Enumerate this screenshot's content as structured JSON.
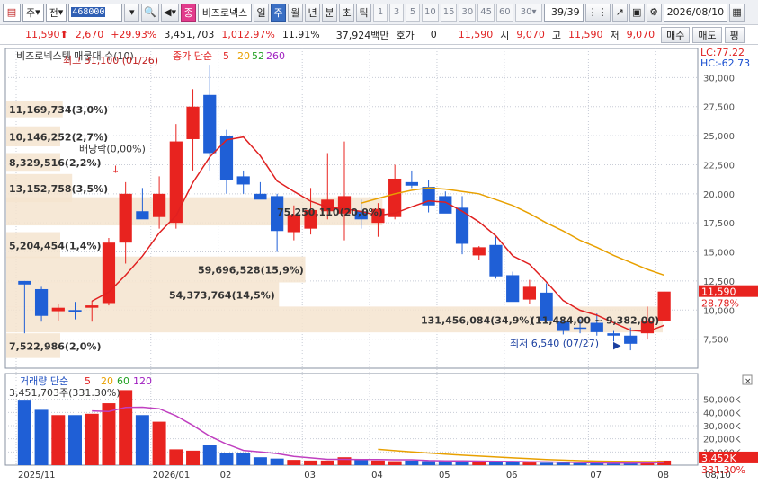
{
  "toolbar": {
    "stock_code": "468000",
    "buy_type": "주",
    "period": "전",
    "stock_name": "비즈로넥스",
    "tabs": [
      "일",
      "주",
      "월",
      "년",
      "분",
      "초",
      "틱"
    ],
    "active_tab": "주",
    "numbers": [
      "1",
      "3",
      "5",
      "10",
      "15",
      "30",
      "45",
      "60",
      "30"
    ],
    "page": "39/39",
    "date": "2026/08/10",
    "badge": "종"
  },
  "quote": {
    "price": "11,590",
    "change": "2,670",
    "change_pct": "+29.93%",
    "volume": "3,451,703",
    "vol_pct": "1,012.97%",
    "turnover": "11.91%",
    "amount": "37,924백만",
    "hoga_label": "호가",
    "hoga_value": "0",
    "bid": "11,590",
    "open_label": "시",
    "open": "9,070",
    "high_label": "고",
    "high": "11,590",
    "low_label": "저",
    "low": "9,070",
    "buy": "매수",
    "sell": "매도",
    "avg": "평"
  },
  "chart_data": {
    "type": "candlestick",
    "price_panel": {
      "title": "비즈로넥스텍 매물대 수(10)",
      "ma_label": "종가 단순",
      "ma_periods": [
        "5",
        "20",
        "52",
        "260"
      ],
      "ma_colors": [
        "#e02020",
        "#e8a000",
        "#20a020",
        "#a020c0"
      ],
      "ylim": [
        5000,
        32500
      ],
      "yticks": [
        7500,
        10000,
        12500,
        15000,
        17500,
        20000,
        22500,
        25000,
        27500,
        30000
      ],
      "ytick_labels": [
        "7,500",
        "10,000",
        "12,500",
        "15,000",
        "17,500",
        "20,000",
        "22,500",
        "25,000",
        "27,500",
        "30,000"
      ],
      "lc": "LC:77.22",
      "hc": "HC:-62.73",
      "price_label": "11,590",
      "pct_label": "28.78%",
      "candles": [
        [
          12500,
          12500,
          8000,
          12200
        ],
        [
          11800,
          12000,
          9000,
          9500
        ],
        [
          9900,
          10500,
          9100,
          10200
        ],
        [
          10000,
          10700,
          9200,
          9800
        ],
        [
          10200,
          10800,
          9000,
          10400
        ],
        [
          10600,
          16200,
          10400,
          15800
        ],
        [
          15800,
          21000,
          14000,
          20000
        ],
        [
          18500,
          20500,
          18000,
          17800
        ],
        [
          18000,
          21500,
          17000,
          20000
        ],
        [
          17500,
          26000,
          17000,
          24500
        ],
        [
          24700,
          29000,
          22000,
          27500
        ],
        [
          28500,
          31100,
          22000,
          23500
        ],
        [
          25000,
          25500,
          20000,
          21200
        ],
        [
          21500,
          22000,
          20000,
          20800
        ],
        [
          20000,
          21000,
          19800,
          19500
        ],
        [
          19800,
          20000,
          15000,
          16800
        ],
        [
          16700,
          19000,
          16000,
          18200
        ],
        [
          17000,
          20500,
          16500,
          18600
        ],
        [
          18500,
          23500,
          17800,
          19500
        ],
        [
          18300,
          24500,
          16000,
          19800
        ],
        [
          18500,
          19500,
          17000,
          17800
        ],
        [
          17500,
          19200,
          16300,
          18700
        ],
        [
          18000,
          22500,
          17800,
          21300
        ],
        [
          21000,
          22000,
          20500,
          20700
        ],
        [
          20600,
          21200,
          18400,
          19000
        ],
        [
          19800,
          20200,
          18400,
          18300
        ],
        [
          18800,
          19800,
          14800,
          15700
        ],
        [
          14700,
          15500,
          14300,
          15400
        ],
        [
          15600,
          16300,
          12700,
          12900
        ],
        [
          13000,
          13300,
          10800,
          10700
        ],
        [
          10900,
          12600,
          10500,
          12000
        ],
        [
          11500,
          12300,
          8900,
          9100
        ],
        [
          9000,
          9200,
          7900,
          8200
        ],
        [
          8500,
          9200,
          8000,
          8400
        ],
        [
          8900,
          9700,
          7800,
          8100
        ],
        [
          8000,
          8200,
          7300,
          7800
        ],
        [
          7800,
          8500,
          6540,
          7100
        ],
        [
          8000,
          10300,
          7500,
          9070
        ],
        [
          9070,
          11590,
          9070,
          11590
        ]
      ],
      "ma5": [
        null,
        null,
        null,
        null,
        10760,
        11540,
        13000,
        14640,
        16640,
        18120,
        20960,
        23180,
        24640,
        24880,
        23280,
        21100,
        20200,
        19360,
        18840,
        18700,
        18480,
        18140,
        18330,
        18880,
        19380,
        19280,
        18500,
        17580,
        16380,
        14660,
        13940,
        12420,
        10820,
        9980,
        9560,
        8900,
        8260,
        8140,
        8690
      ],
      "ma20": [
        null,
        null,
        null,
        null,
        null,
        null,
        null,
        null,
        null,
        null,
        null,
        null,
        null,
        null,
        null,
        null,
        null,
        null,
        null,
        null,
        19200,
        19600,
        20000,
        20300,
        20500,
        20400,
        20200,
        20000,
        19500,
        19000,
        18300,
        17500,
        16800,
        16000,
        15400,
        14700,
        14100,
        13500,
        13000
      ]
    },
    "volume_panel": {
      "title": "거래량 단순",
      "ma_periods": [
        "5",
        "20",
        "60",
        "120"
      ],
      "ma_colors": [
        "#e02020",
        "#e8a000",
        "#20a020",
        "#a020c0"
      ],
      "ylim": [
        0,
        60000
      ],
      "yticks": [
        10000,
        20000,
        30000,
        40000,
        50000
      ],
      "ytick_labels": [
        "10,000K",
        "20,000K",
        "30,000K",
        "40,000K",
        "50,000K"
      ],
      "annotation": "3,451,703주(331.30%)",
      "value_label": "3,452K",
      "pct_label": "331.30%",
      "volumes": [
        49000,
        42000,
        38000,
        38000,
        39000,
        47000,
        57000,
        38000,
        33000,
        12000,
        11000,
        15000,
        9000,
        9000,
        6000,
        5000,
        4000,
        3500,
        3500,
        6000,
        4500,
        3500,
        3000,
        3500,
        3000,
        3500,
        2800,
        3000,
        2500,
        2200,
        2000,
        1800,
        1800,
        1500,
        1500,
        1200,
        1500,
        2500,
        3452
      ],
      "ma5": [
        null,
        null,
        null,
        null,
        41200,
        40800,
        43800,
        44000,
        42800,
        37400,
        30200,
        22000,
        16000,
        11200,
        10000,
        8800,
        6600,
        5500,
        4400,
        4400,
        4300,
        4200,
        4100,
        4100,
        3500,
        3300,
        3200,
        3100,
        2960,
        2800,
        2600,
        2460,
        2240,
        1960,
        1760,
        1560,
        1500,
        1700,
        2030
      ],
      "ma20_start": 21,
      "ma20": [
        12000,
        11000,
        10000,
        9200,
        8400,
        7600,
        6900,
        6200,
        5500,
        4900,
        4300,
        3800,
        3400,
        3100,
        2900,
        2800,
        2700,
        2750
      ]
    },
    "x_labels": [
      "2025/11",
      "2026/01",
      "02",
      "03",
      "04",
      "05",
      "06",
      "07",
      "08"
    ],
    "x_label_index": [
      0,
      8,
      12,
      17,
      21,
      25,
      29,
      34,
      38
    ],
    "right_x_label": "08/10",
    "annotations": {
      "high_text": "최고 31,100 (01/26)",
      "low_text": "최저 6,540 (07/27)",
      "ex_dividend": "배당락(0,00%)",
      "volume_profile": [
        {
          "label": "11,169,734(3,0%)",
          "lo": 26500,
          "hi": 28000,
          "pct": 3.0
        },
        {
          "label": "10,146,252(2,7%)",
          "lo": 24000,
          "hi": 25800,
          "pct": 2.7
        },
        {
          "label": "8,329,516(2,2%)",
          "lo": 21900,
          "hi": 23500,
          "pct": 2.2
        },
        {
          "label": "13,152,758(3,5%)",
          "lo": 19200,
          "hi": 21700,
          "pct": 3.5
        },
        {
          "label": "75,250,110(20,0%)",
          "lo": 17200,
          "hi": 19700,
          "pct": 20.0
        },
        {
          "label": "5,204,454(1,4%)",
          "lo": 14400,
          "hi": 16700,
          "pct": 1.4
        },
        {
          "label": "59,696,528(15,9%)",
          "lo": 12300,
          "hi": 14600,
          "pct": 15.9
        },
        {
          "label": "54,373,764(14,5%)",
          "lo": 10200,
          "hi": 12400,
          "pct": 14.5
        },
        {
          "label": "131,456,084(34,9%)",
          "lo": 8000,
          "hi": 10300,
          "pct": 34.9
        },
        {
          "label": "7,522,986(2,0%)",
          "lo": 5800,
          "hi": 8000,
          "pct": 2.0
        }
      ],
      "range_label": "(11,484,00 ~ 9,382,00)"
    }
  }
}
